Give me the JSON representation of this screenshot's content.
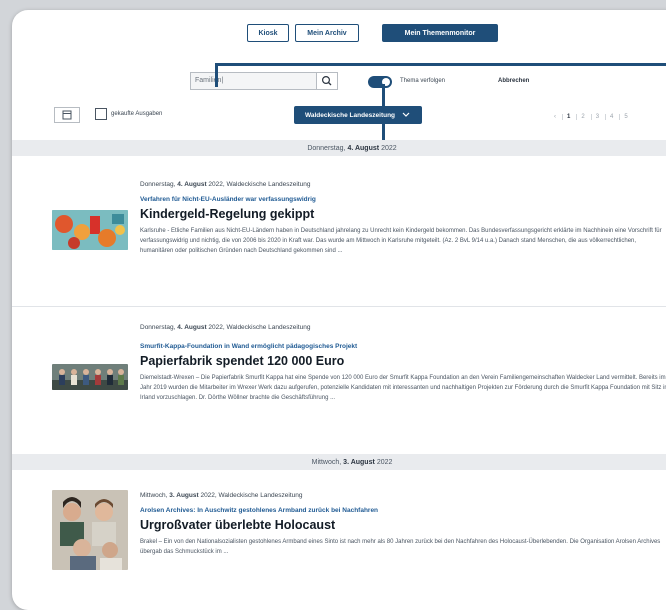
{
  "toolbar": {
    "kiosk_label": "Kiosk",
    "my_abo_label": "Mein Archiv",
    "monitor_label": "Mein Themenmonitor"
  },
  "search": {
    "value": "Familien|",
    "toggle_label": "Thema verfolgen",
    "cancel_label": "Abbrechen"
  },
  "filters": {
    "bought_label": "gekaufte Ausgaben",
    "edition_label": "Waldeckische Landeszeitung",
    "pages": [
      "1",
      "2",
      "3",
      "4",
      "5"
    ]
  },
  "groups": [
    {
      "date_prefix": "Donnerstag,",
      "date_bold": "4. August",
      "date_year": "2022"
    },
    {
      "date_prefix": "Mittwoch,",
      "date_bold": "3. August",
      "date_year": "2022"
    }
  ],
  "articles": [
    {
      "meta_prefix": "Donnerstag,",
      "meta_bold": "4. August",
      "meta_suffix": "2022, Waldeckische Landeszeitung",
      "kicker": "Verfahren für Nicht-EU-Ausländer war verfassungswidrig",
      "headline": "Kindergeld-Regelung gekippt",
      "teaser": "Karlsruhe - Etliche Familien aus Nicht-EU-Ländern haben in Deutschland jahrelang zu Unrecht kein Kindergeld bekommen. Das Bundesverfassungsgericht erklärte im Nachhinein eine Vorschrift für verfassungswidrig und nichtig, die von 2006 bis 2020 in Kraft war. Das wurde am Mittwoch in Karlsruhe mitgeteilt. (Az. 2 BvL 9/14 u.a.) Danach stand Menschen, die aus völkerrechtlichen, humanitären oder politischen Gründen nach Deutschland gekommen sind ..."
    },
    {
      "meta_prefix": "Donnerstag,",
      "meta_bold": "4. August",
      "meta_suffix": "2022, Waldeckische Landeszeitung",
      "kicker": "Smurfit-Kappa-Foundation in Wand ermöglicht pädagogisches Projekt",
      "headline": "Papierfabrik spendet 120 000 Euro",
      "teaser": "Diemelstadt-Wrexen – Die Papierfabrik Smurfit Kappa hat eine Spende von 120 000 Euro der Smurfit Kappa Foundation an den Verein Familiengemeinschaften Waldecker Land vermittelt. Bereits im Jahr 2019 wurden die Mitarbeiter im Wrexer Werk dazu aufgerufen, potenzielle Kandidaten mit interessanten und nachhaltigen Projekten zur Förderung durch die Smurfit Kappa Foundation mit Sitz in Irland vorzuschlagen. Dr. Dörthe Wöllner brachte die Geschäftsführung ..."
    },
    {
      "meta_prefix": "Mittwoch,",
      "meta_bold": "3. August",
      "meta_suffix": "2022, Waldeckische Landeszeitung",
      "kicker": "Arolsen Archives: In Auschwitz gestohlenes Armband zurück bei Nachfahren",
      "headline": "Urgroßvater überlebte Holocaust",
      "teaser": "Brakel – Ein von den Nationalsozialisten gestohlenes Armband eines Sinto ist nach mehr als 80 Jahren zurück bei den Nachfahren des Holocaust-Überlebenden. Die Organisation Arolsen Archives übergab das Schmuckstück im ..."
    }
  ],
  "colors": {
    "accent": "#1f4e79",
    "kicker": "#1f5a93",
    "datebar": "#e9ebee"
  }
}
